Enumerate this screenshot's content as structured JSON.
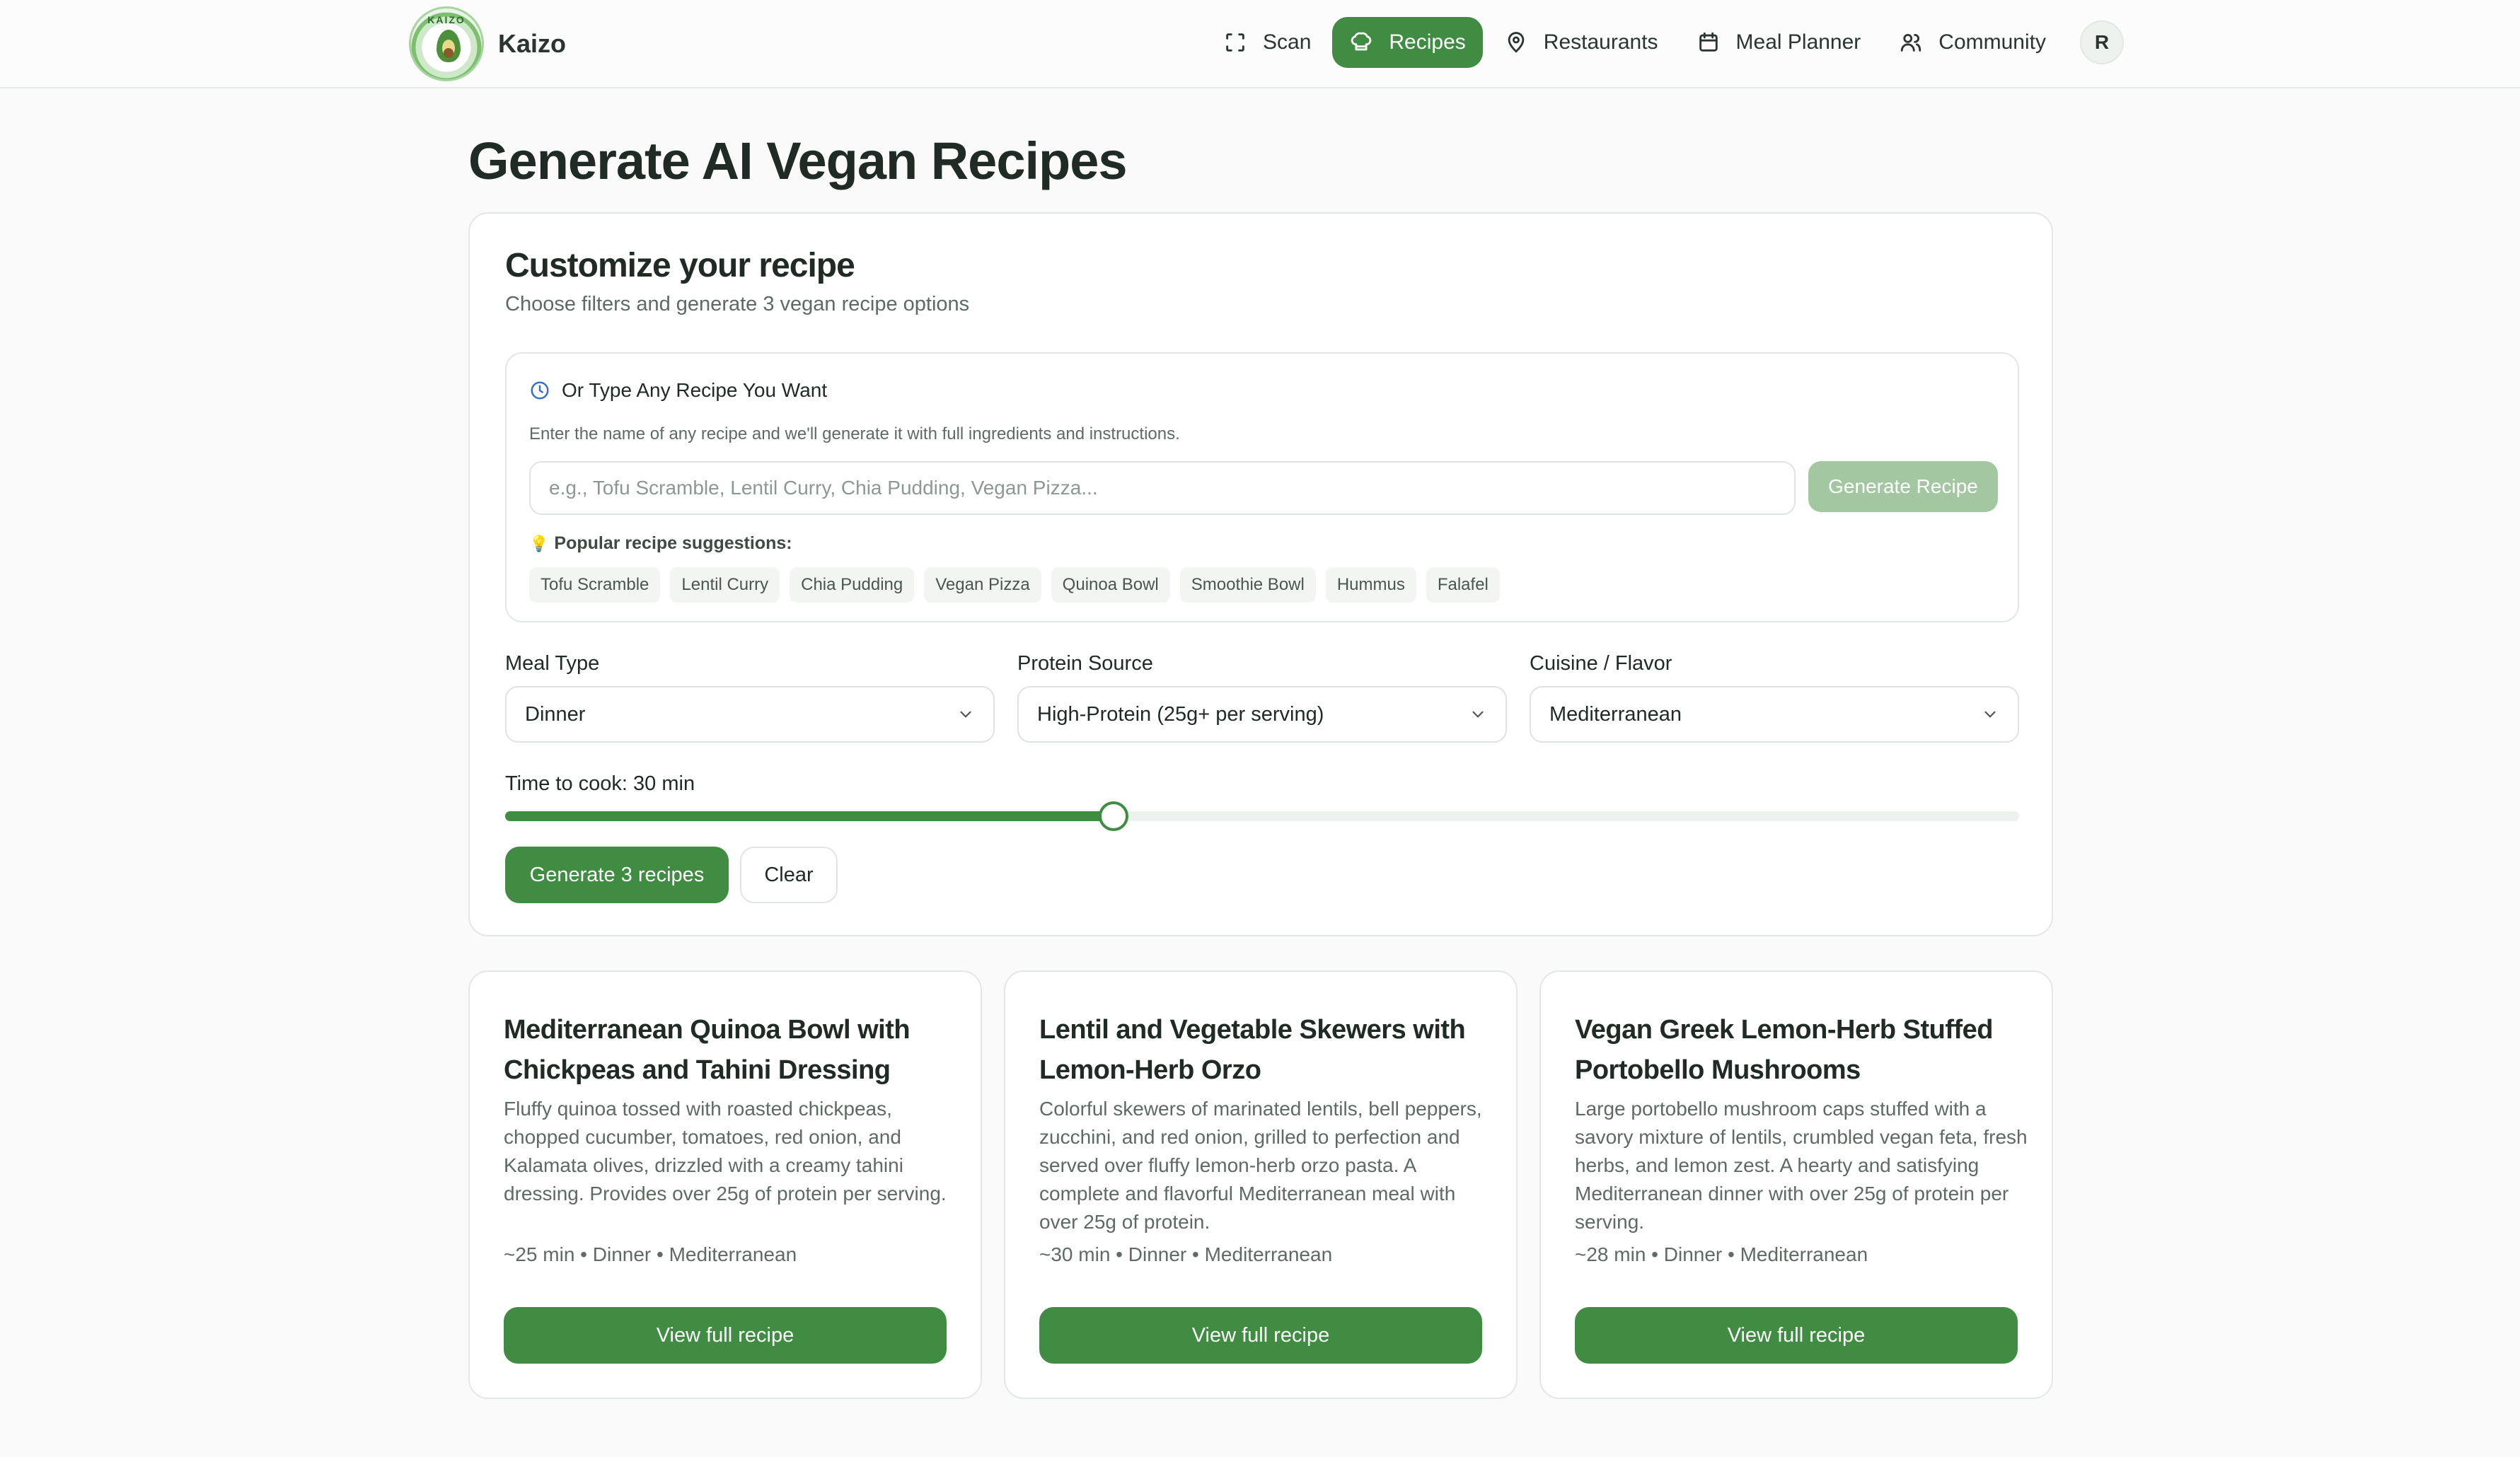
{
  "app": {
    "name": "Kaizo",
    "logo_text": "KAIZO"
  },
  "nav": {
    "items": [
      {
        "label": "Scan",
        "icon": "scan-icon"
      },
      {
        "label": "Recipes",
        "icon": "chef-hat-icon",
        "active": true
      },
      {
        "label": "Restaurants",
        "icon": "map-pin-icon"
      },
      {
        "label": "Meal Planner",
        "icon": "calendar-icon"
      },
      {
        "label": "Community",
        "icon": "users-icon"
      }
    ],
    "avatar": "R"
  },
  "page": {
    "title": "Generate AI Vegan Recipes"
  },
  "customize": {
    "title": "Customize your recipe",
    "subtitle": "Choose filters and generate 3 vegan recipe options",
    "type_any": {
      "heading": "Or Type Any Recipe You Want",
      "description": "Enter the name of any recipe and we'll generate it with full ingredients and instructions.",
      "input_value": "",
      "input_placeholder": "e.g., Tofu Scramble, Lentil Curry, Chia Pudding, Vegan Pizza...",
      "button": "Generate Recipe",
      "suggestions_label": "Popular recipe suggestions:",
      "suggestions": [
        "Tofu Scramble",
        "Lentil Curry",
        "Chia Pudding",
        "Vegan Pizza",
        "Quinoa Bowl",
        "Smoothie Bowl",
        "Hummus",
        "Falafel"
      ]
    },
    "filters": {
      "meal_type": {
        "label": "Meal Type",
        "value": "Dinner"
      },
      "protein": {
        "label": "Protein Source",
        "value": "High-Protein (25g+ per serving)"
      },
      "cuisine": {
        "label": "Cuisine / Flavor",
        "value": "Mediterranean"
      }
    },
    "time": {
      "label": "Time to cook: 30 min",
      "fraction": 0.402
    },
    "generate_button": "Generate 3 recipes",
    "clear_button": "Clear"
  },
  "recipes": [
    {
      "title": "Mediterranean Quinoa Bowl with Chickpeas and Tahini Dressing",
      "description": "Fluffy quinoa tossed with roasted chickpeas, chopped cucumber, tomatoes, red onion, and Kalamata olives, drizzled with a creamy tahini dressing. Provides over 25g of protein per serving.",
      "meta": "~25 min • Dinner • Mediterranean",
      "button": "View full recipe"
    },
    {
      "title": "Lentil and Vegetable Skewers with Lemon-Herb Orzo",
      "description": "Colorful skewers of marinated lentils, bell peppers, zucchini, and red onion, grilled to perfection and served over fluffy lemon-herb orzo pasta. A complete and flavorful Mediterranean meal with over 25g of protein.",
      "meta": "~30 min • Dinner • Mediterranean",
      "button": "View full recipe"
    },
    {
      "title": "Vegan Greek Lemon-Herb Stuffed Portobello Mushrooms",
      "description": "Large portobello mushroom caps stuffed with a savory mixture of lentils, crumbled vegan feta, fresh herbs, and lemon zest. A hearty and satisfying Mediterranean dinner with over 25g of protein per serving.",
      "meta": "~28 min • Dinner • Mediterranean",
      "button": "View full recipe"
    }
  ],
  "colors": {
    "primary": "#3f8c42",
    "primary_muted": "#a3c8a1",
    "background": "#f9faf9"
  }
}
